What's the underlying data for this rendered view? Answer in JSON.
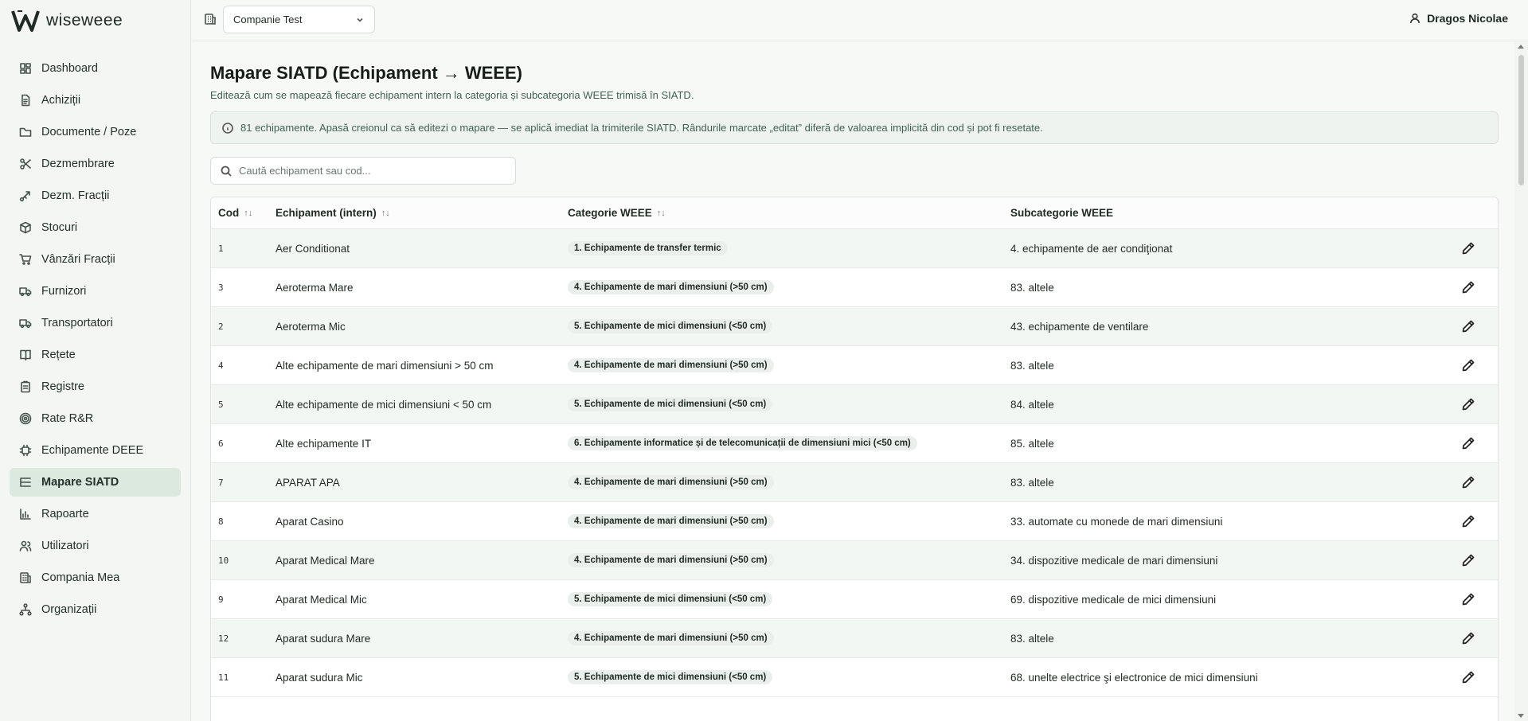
{
  "app": {
    "brand": "wiseweee"
  },
  "sidebar": {
    "items": [
      {
        "label": "Dashboard",
        "icon": "dashboard-icon"
      },
      {
        "label": "Achiziții",
        "icon": "file-icon"
      },
      {
        "label": "Documente / Poze",
        "icon": "folder-icon"
      },
      {
        "label": "Dezmembrare",
        "icon": "scissors-icon"
      },
      {
        "label": "Dezm. Fracții",
        "icon": "split-icon"
      },
      {
        "label": "Stocuri",
        "icon": "box-icon"
      },
      {
        "label": "Vânzări Fracții",
        "icon": "cart-icon"
      },
      {
        "label": "Furnizori",
        "icon": "truck-icon"
      },
      {
        "label": "Transportatori",
        "icon": "truck-icon"
      },
      {
        "label": "Rețete",
        "icon": "book-icon"
      },
      {
        "label": "Registre",
        "icon": "clipboard-icon"
      },
      {
        "label": "Rate R&R",
        "icon": "target-icon"
      },
      {
        "label": "Echipamente DEEE",
        "icon": "chip-icon"
      },
      {
        "label": "Mapare SIATD",
        "icon": "list-tree-icon"
      },
      {
        "label": "Rapoarte",
        "icon": "bar-chart-icon"
      },
      {
        "label": "Utilizatori",
        "icon": "users-icon"
      },
      {
        "label": "Compania Mea",
        "icon": "building-icon"
      },
      {
        "label": "Organizații",
        "icon": "network-icon"
      }
    ],
    "active": "Mapare SIATD"
  },
  "topbar": {
    "company": "Companie Test",
    "user": "Dragos Nicolae"
  },
  "main": {
    "title": "Mapare SIATD (Echipament → WEEE)",
    "subtitle": "Editează cum se mapează fiecare echipament intern la categoria și subcategoria WEEE trimisă în SIATD.",
    "info": "81 echipamente. Apasă creionul ca să editezi o mapare — se aplică imediat la trimiterile SIATD. Rândurile marcate „editat” diferă de valoarea implicită din cod și pot fi resetate.",
    "search_placeholder": "Caută echipament sau cod..."
  },
  "table": {
    "headers": {
      "cod": "Cod",
      "equipment": "Echipament (intern)",
      "category": "Categorie WEEE",
      "subcategory": "Subcategorie WEEE",
      "sort_icon": "↑↓"
    },
    "rows": [
      {
        "cod": "1",
        "equipment": "Aer Conditionat",
        "category": "1. Echipamente de transfer termic",
        "subcategory": "4. echipamente de aer condiţionat"
      },
      {
        "cod": "3",
        "equipment": "Aeroterma Mare",
        "category": "4. Echipamente de mari dimensiuni (>50 cm)",
        "subcategory": "83. altele"
      },
      {
        "cod": "2",
        "equipment": "Aeroterma Mic",
        "category": "5. Echipamente de mici dimensiuni (<50 cm)",
        "subcategory": "43. echipamente de ventilare"
      },
      {
        "cod": "4",
        "equipment": "Alte echipamente de mari dimensiuni > 50 cm",
        "category": "4. Echipamente de mari dimensiuni (>50 cm)",
        "subcategory": "83. altele"
      },
      {
        "cod": "5",
        "equipment": "Alte echipamente de mici dimensiuni < 50 cm",
        "category": "5. Echipamente de mici dimensiuni (<50 cm)",
        "subcategory": "84. altele"
      },
      {
        "cod": "6",
        "equipment": "Alte echipamente IT",
        "category": "6. Echipamente informatice și de telecomunicații de dimensiuni mici (<50 cm)",
        "subcategory": "85. altele"
      },
      {
        "cod": "7",
        "equipment": "APARAT APA",
        "category": "4. Echipamente de mari dimensiuni (>50 cm)",
        "subcategory": "83. altele"
      },
      {
        "cod": "8",
        "equipment": "Aparat Casino",
        "category": "4. Echipamente de mari dimensiuni (>50 cm)",
        "subcategory": "33. automate cu monede de mari dimensiuni"
      },
      {
        "cod": "10",
        "equipment": "Aparat Medical Mare",
        "category": "4. Echipamente de mari dimensiuni (>50 cm)",
        "subcategory": "34. dispozitive medicale de mari dimensiuni"
      },
      {
        "cod": "9",
        "equipment": "Aparat Medical Mic",
        "category": "5. Echipamente de mici dimensiuni (<50 cm)",
        "subcategory": "69. dispozitive medicale de mici dimensiuni"
      },
      {
        "cod": "12",
        "equipment": "Aparat sudura Mare",
        "category": "4. Echipamente de mari dimensiuni (>50 cm)",
        "subcategory": "83. altele"
      },
      {
        "cod": "11",
        "equipment": "Aparat sudura Mic",
        "category": "5. Echipamente de mici dimensiuni (<50 cm)",
        "subcategory": "68. unelte electrice şi electronice de mici dimensiuni"
      }
    ]
  }
}
